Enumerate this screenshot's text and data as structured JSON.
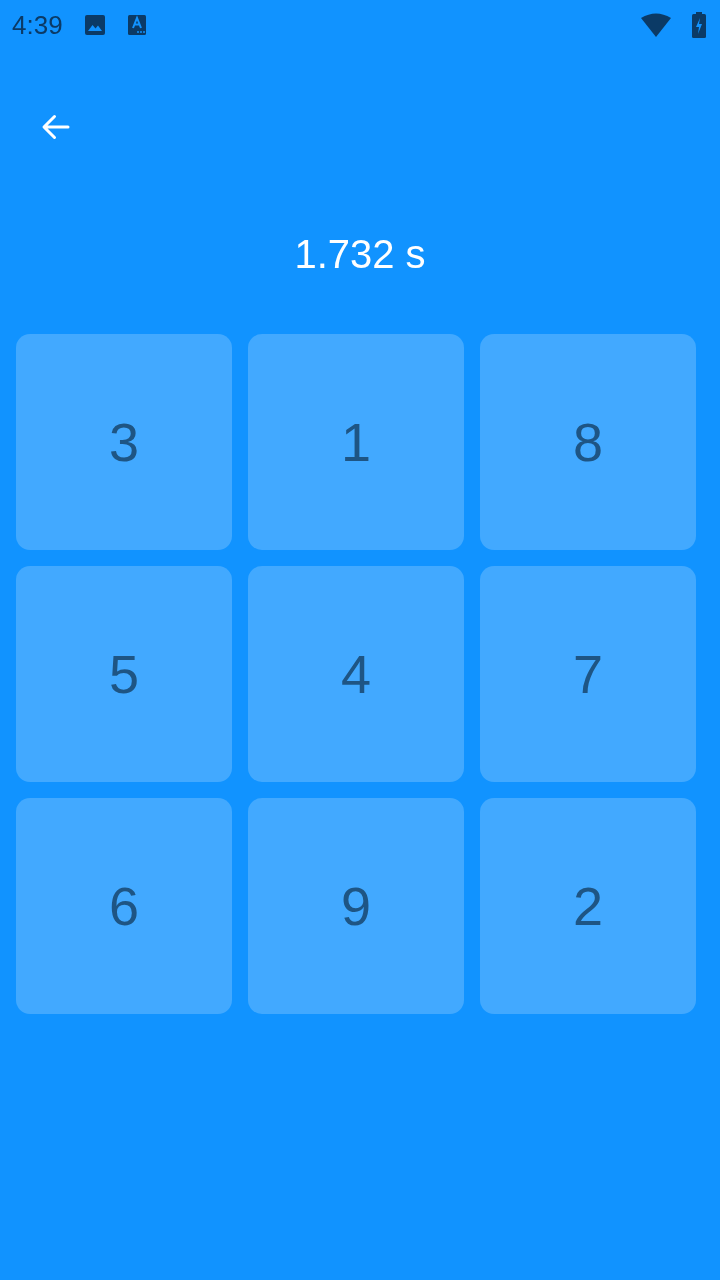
{
  "status_bar": {
    "time": "4:39"
  },
  "timer": "1.732 s",
  "tiles": [
    "3",
    "1",
    "8",
    "5",
    "4",
    "7",
    "6",
    "9",
    "2"
  ]
}
